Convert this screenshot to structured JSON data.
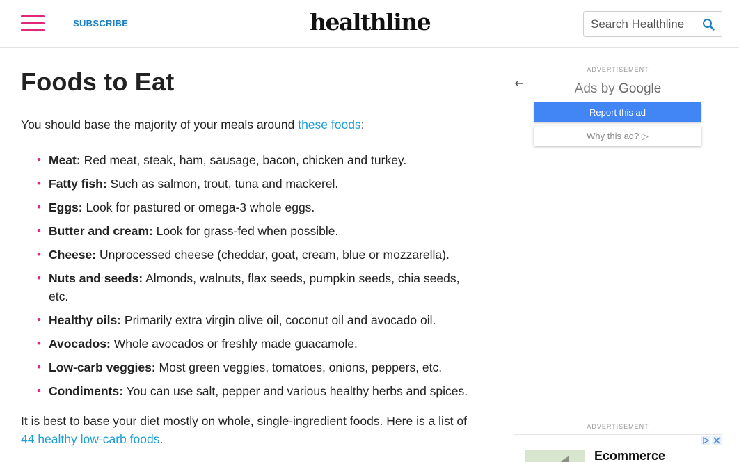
{
  "header": {
    "subscribe_label": "SUBSCRIBE",
    "logo_text": "healthline",
    "search_placeholder": "Search Healthline"
  },
  "article": {
    "heading": "Foods to Eat",
    "intro_text": "You should base the majority of your meals around ",
    "intro_link": "these foods",
    "intro_end": ":",
    "items": [
      {
        "term": "Meat:",
        "desc": " Red meat, steak, ham, sausage, bacon, chicken and turkey."
      },
      {
        "term": "Fatty fish:",
        "desc": " Such as salmon, trout, tuna and mackerel."
      },
      {
        "term": "Eggs:",
        "desc": " Look for pastured or omega-3 whole eggs."
      },
      {
        "term": "Butter and cream:",
        "desc": " Look for grass-fed when possible."
      },
      {
        "term": "Cheese:",
        "desc": " Unprocessed cheese (cheddar, goat, cream, blue or mozzarella)."
      },
      {
        "term": "Nuts and seeds:",
        "desc": " Almonds, walnuts, flax seeds, pumpkin seeds, chia seeds, etc."
      },
      {
        "term": "Healthy oils:",
        "desc": " Primarily extra virgin olive oil, coconut oil and avocado oil."
      },
      {
        "term": "Avocados:",
        "desc": " Whole avocados or freshly made guacamole."
      },
      {
        "term": "Low-carb veggies:",
        "desc": " Most green veggies, tomatoes, onions, peppers, etc."
      },
      {
        "term": "Condiments:",
        "desc": " You can use salt, pepper and various healthy herbs and spices."
      }
    ],
    "outro_text": "It is best to base your diet mostly on whole, single-ingredient foods. Here is a list of ",
    "outro_link": "44 healthy low-carb foods",
    "outro_end": "."
  },
  "sidebar": {
    "ad_label_1": "ADVERTISEMENT",
    "ads_by_prefix": "Ads by ",
    "ads_by_brand": "Google",
    "report_label": "Report this ad",
    "why_label": "Why this ad? ▷",
    "ad_label_2": "ADVERTISEMENT",
    "ad2_title": "Ecommerce"
  },
  "colors": {
    "accent_pink": "#e3267a",
    "link_blue": "#1a9fd8",
    "google_blue": "#4285f4"
  }
}
